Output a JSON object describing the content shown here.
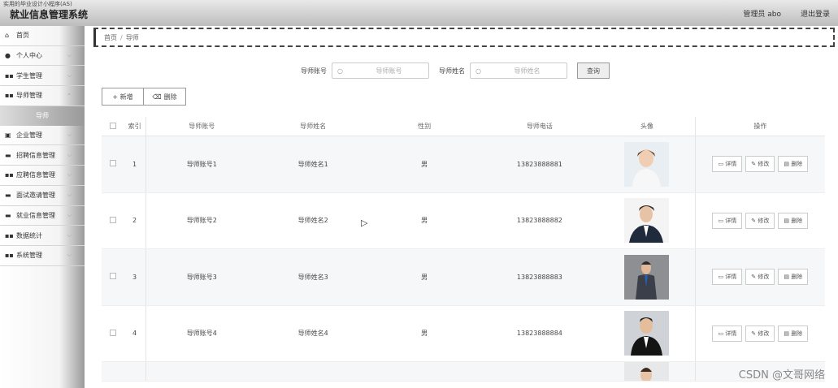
{
  "header": {
    "tiny_text": "实用的毕业设计小程序(AS)",
    "title": "就业信息管理系统",
    "user": "管理员 abo",
    "logout": "退出登录"
  },
  "sidebar": {
    "items": [
      {
        "label": "首页",
        "icon": "home-icon"
      },
      {
        "label": "个人中心",
        "icon": "user-icon"
      },
      {
        "label": "学生管理",
        "icon": "grid-icon"
      },
      {
        "label": "导师管理",
        "icon": "grid-icon"
      },
      {
        "label": "企业管理",
        "icon": "doc-icon"
      },
      {
        "label": "招聘信息管理",
        "icon": "chat-icon"
      },
      {
        "label": "应聘信息管理",
        "icon": "grid-icon"
      },
      {
        "label": "面试邀请管理",
        "icon": "chat-icon"
      },
      {
        "label": "就业信息管理",
        "icon": "chat-icon"
      },
      {
        "label": "数据统计",
        "icon": "grid-icon"
      },
      {
        "label": "系统管理",
        "icon": "grid-icon"
      }
    ],
    "active_sub": "导师"
  },
  "breadcrumb": {
    "home": "首页",
    "sep": "/",
    "current": "导师"
  },
  "search": {
    "label1": "导师账号",
    "placeholder1": "导师账号",
    "label2": "导师姓名",
    "placeholder2": "导师姓名",
    "query_button": "查询"
  },
  "actions": {
    "add": "+ 新增",
    "delete": "删除"
  },
  "table": {
    "headers": [
      "索引",
      "导师账号",
      "导师姓名",
      "性别",
      "导师电话",
      "头像",
      "操作"
    ],
    "rows": [
      {
        "index": "1",
        "account": "导师账号1",
        "name": "导师姓名1",
        "gender": "男",
        "phone": "13823888881"
      },
      {
        "index": "2",
        "account": "导师账号2",
        "name": "导师姓名2",
        "gender": "男",
        "phone": "13823888882"
      },
      {
        "index": "3",
        "account": "导师账号3",
        "name": "导师姓名3",
        "gender": "男",
        "phone": "13823888883"
      },
      {
        "index": "4",
        "account": "导师账号4",
        "name": "导师姓名4",
        "gender": "男",
        "phone": "13823888884"
      }
    ],
    "ops": {
      "detail": "详情",
      "edit": "修改",
      "delete": "删除"
    }
  },
  "watermark": "CSDN @文哥网络"
}
